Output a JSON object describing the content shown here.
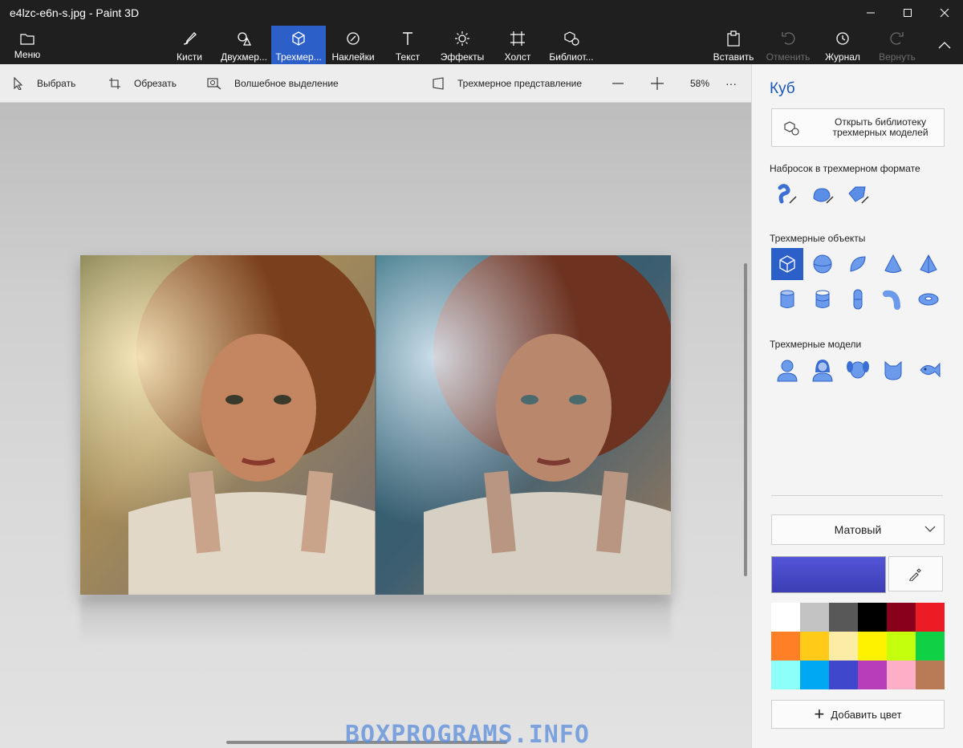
{
  "window": {
    "title": "e4lzc-e6n-s.jpg - Paint 3D"
  },
  "ribbon": {
    "menu": "Меню",
    "tools": [
      {
        "label": "Кисти"
      },
      {
        "label": "Двухмер..."
      },
      {
        "label": "Трехмер..."
      },
      {
        "label": "Наклейки"
      },
      {
        "label": "Текст"
      },
      {
        "label": "Эффекты"
      },
      {
        "label": "Холст"
      },
      {
        "label": "Библиот..."
      }
    ],
    "actions": [
      {
        "label": "Вставить"
      },
      {
        "label": "Отменить"
      },
      {
        "label": "Журнал"
      },
      {
        "label": "Вернуть"
      }
    ]
  },
  "toolbar": {
    "select": "Выбрать",
    "crop": "Обрезать",
    "magic_select": "Волшебное выделение",
    "view_3d": "Трехмерное представление",
    "zoom": "58%",
    "more": "···"
  },
  "panel": {
    "title": "Куб",
    "library_button": "Открыть библиотеку трехмерных моделей",
    "library_line1": "Открыть библиотеку",
    "library_line2": "трехмерных моделей",
    "sketch_title": "Набросок в трехмерном формате",
    "objects_title": "Трехмерные объекты",
    "models_title": "Трехмерные модели",
    "material": "Матовый",
    "add_color": "Добавить цвет",
    "current_color": "#3c3eb4",
    "palette": [
      "#ffffff",
      "#c3c3c3",
      "#585858",
      "#000000",
      "#88001b",
      "#ec1c24",
      "#ff7f27",
      "#ffca18",
      "#fdeca6",
      "#fff200",
      "#c4ff0e",
      "#0ed145",
      "#8cfffb",
      "#00a8f3",
      "#3f48cc",
      "#b83dba",
      "#ffaec8",
      "#b97a56"
    ]
  },
  "watermark": "BOXPROGRAMS.INFO"
}
